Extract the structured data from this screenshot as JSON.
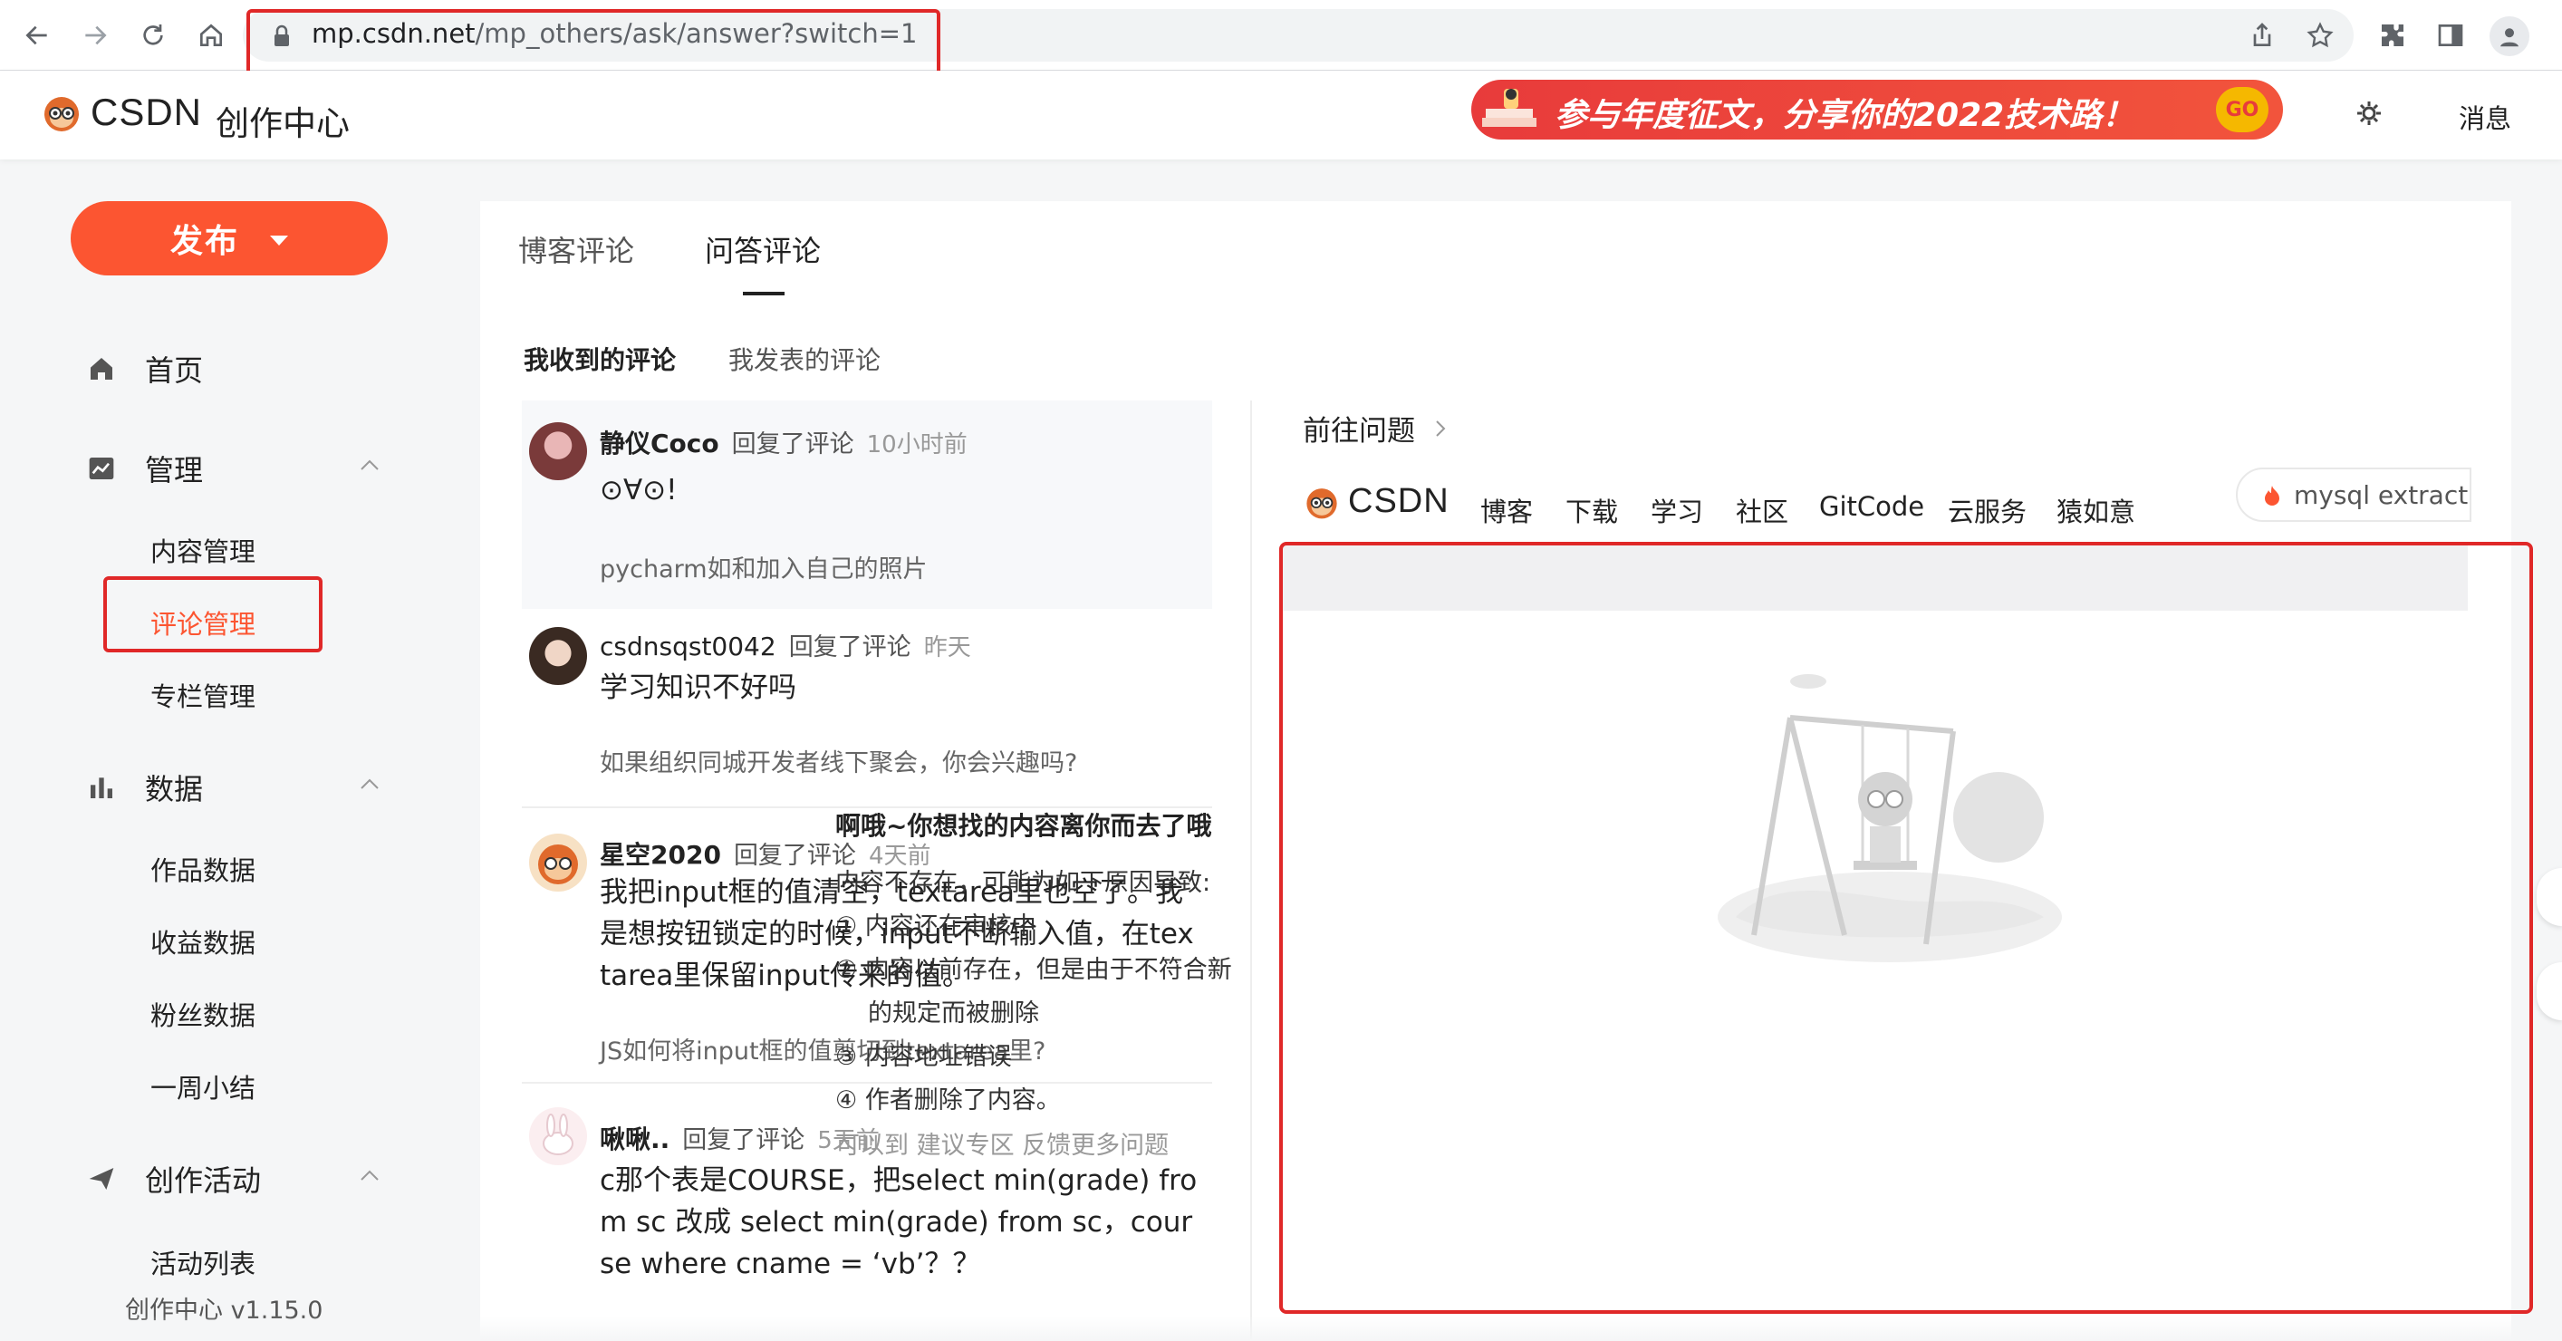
{
  "browser": {
    "url_domain": "mp.csdn.net",
    "url_path": "/mp_others/ask/answer?switch=1"
  },
  "header": {
    "logo_text": "CSDN",
    "section_title": "创作中心",
    "banner_text": "参与年度征文，分享你的2022技术路！",
    "banner_go": "GO",
    "messages": "消息"
  },
  "sidebar": {
    "publish_label": "发布",
    "home": "首页",
    "manage": "管理",
    "manage_items": [
      "内容管理",
      "评论管理",
      "专栏管理"
    ],
    "data": "数据",
    "data_items": [
      "作品数据",
      "收益数据",
      "粉丝数据",
      "一周小结"
    ],
    "activity": "创作活动",
    "activity_items": [
      "活动列表"
    ],
    "version": "创作中心 v1.15.0"
  },
  "main": {
    "tabs": [
      "博客评论",
      "问答评论"
    ],
    "subtabs": [
      "我收到的评论",
      "我发表的评论"
    ],
    "comments": [
      {
        "user": "静仪Coco",
        "action": "回复了评论",
        "time": "10小时前",
        "body": "⊙∀⊙!",
        "ref": "pycharm如和加入自己的照片"
      },
      {
        "user": "csdnsqst0042",
        "action": "回复了评论",
        "time": "昨天",
        "body": "学习知识不好吗",
        "ref": "如果组织同城开发者线下聚会，你会兴趣吗?"
      },
      {
        "user": "星空2020",
        "action": "回复了评论",
        "time": "4天前",
        "body": "我把input框的值清空，textarea里也空了。我是想按钮锁定的时候，input不断输入值，在textarea里保留input传来的值。",
        "ref": "JS如何将input框的值剪切到textarea里?"
      },
      {
        "user": "啾啾..",
        "action": "回复了评论",
        "time": "5天前",
        "body": "c那个表是COURSE，把select min(grade) from sc 改成 select min(grade) from sc，course where cname = ‘vb’？？",
        "ref": ""
      }
    ]
  },
  "preview": {
    "title": "前往问题",
    "nav": [
      "博客",
      "下载",
      "学习",
      "社区",
      "GitCode",
      "云服务",
      "猿如意"
    ],
    "search_text": "mysql extract",
    "notfound": "啊哦~你想找的内容离你而去了哦",
    "reasons_title": "内容不存在，可能为如下原因导致:",
    "reasons": [
      "① 内容还在审核中",
      "② 内容以前存在，但是由于不符合新",
      "的规定而被删除",
      "③ 内容地址错误",
      "④ 作者删除了内容。"
    ],
    "more_text": "可以到 建议专区 反馈更多问题"
  },
  "colors": {
    "brand": "#fc5531",
    "highlight_frame": "#e02828"
  }
}
